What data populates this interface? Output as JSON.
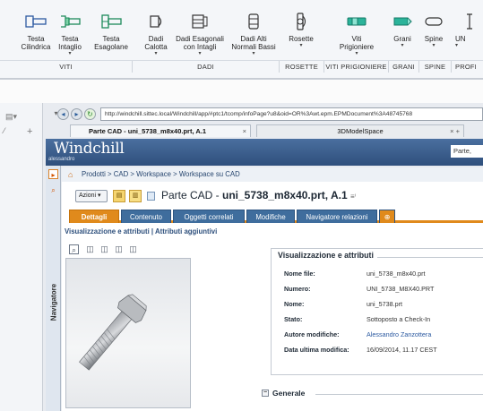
{
  "ribbon": {
    "buttons": [
      {
        "l1": "Testa",
        "l2": "Cilindrica"
      },
      {
        "l1": "Testa",
        "l2": "Intaglio"
      },
      {
        "l1": "Testa",
        "l2": "Esagolane"
      },
      {
        "l1": "Dadi",
        "l2": "Calotta"
      },
      {
        "l1": "Dadi Esagonali",
        "l2": "con Intagli"
      },
      {
        "l1": "Dadi Alti",
        "l2": "Normali Bassi"
      },
      {
        "l1": "Rosette",
        "l2": ""
      },
      {
        "l1": "Viti",
        "l2": "Prigioniere"
      },
      {
        "l1": "Grani",
        "l2": ""
      },
      {
        "l1": "Spine",
        "l2": ""
      },
      {
        "l1": "UN",
        "l2": ""
      }
    ],
    "groups": [
      "VITI",
      "DADI",
      "ROSETTE",
      "VITI PRIGIONIERE",
      "GRANI",
      "SPINE",
      "PROFI"
    ]
  },
  "browser": {
    "url": "http://windchill.sittec.local/Windchill/app/#ptc1/tcomp/infoPage?u8&oid=OR%3Awt.epm.EPMDocument%3A48745768",
    "tab1": "Parte CAD - uni_5738_m8x40.prt, A.1",
    "tab2": "3DModelSpace"
  },
  "windchill": {
    "logo": "Windchill",
    "user": "alessandro",
    "search_value": "Parte,",
    "navigator_label": "Navigatore",
    "breadcrumb": "Prodotti > CAD > Workspace > Workspace su CAD",
    "actions_label": "Azioni",
    "title_prefix": "Parte CAD - ",
    "title_bold": "uni_5738_m8x40.prt, A.1",
    "tabs": [
      "Dettagli",
      "Contenuto",
      "Oggetti correlati",
      "Modifiche",
      "Navigatore relazioni"
    ],
    "sublinks": "Visualizzazione e attributi | Attributi aggiuntivi",
    "info_title": "Visualizzazione e attributi",
    "attributes": [
      {
        "k": "Nome file:",
        "v": "uni_5738_m8x40.prt"
      },
      {
        "k": "Numero:",
        "v": "UNI_5738_M8X40.PRT"
      },
      {
        "k": "Nome:",
        "v": "uni_5738.prt"
      },
      {
        "k": "Stato:",
        "v": "Sottoposto a Check-In"
      },
      {
        "k": "Autore modifiche:",
        "v": "Alessandro Zanzottera"
      },
      {
        "k": "Data ultima modifica:",
        "v": "16/09/2014, 11.17 CEST"
      }
    ],
    "section_generale": "Generale"
  },
  "colors": {
    "accent_orange": "#e08a1c",
    "tab_blue": "#3f6d9d",
    "header_blue": "#3c5e8c"
  }
}
